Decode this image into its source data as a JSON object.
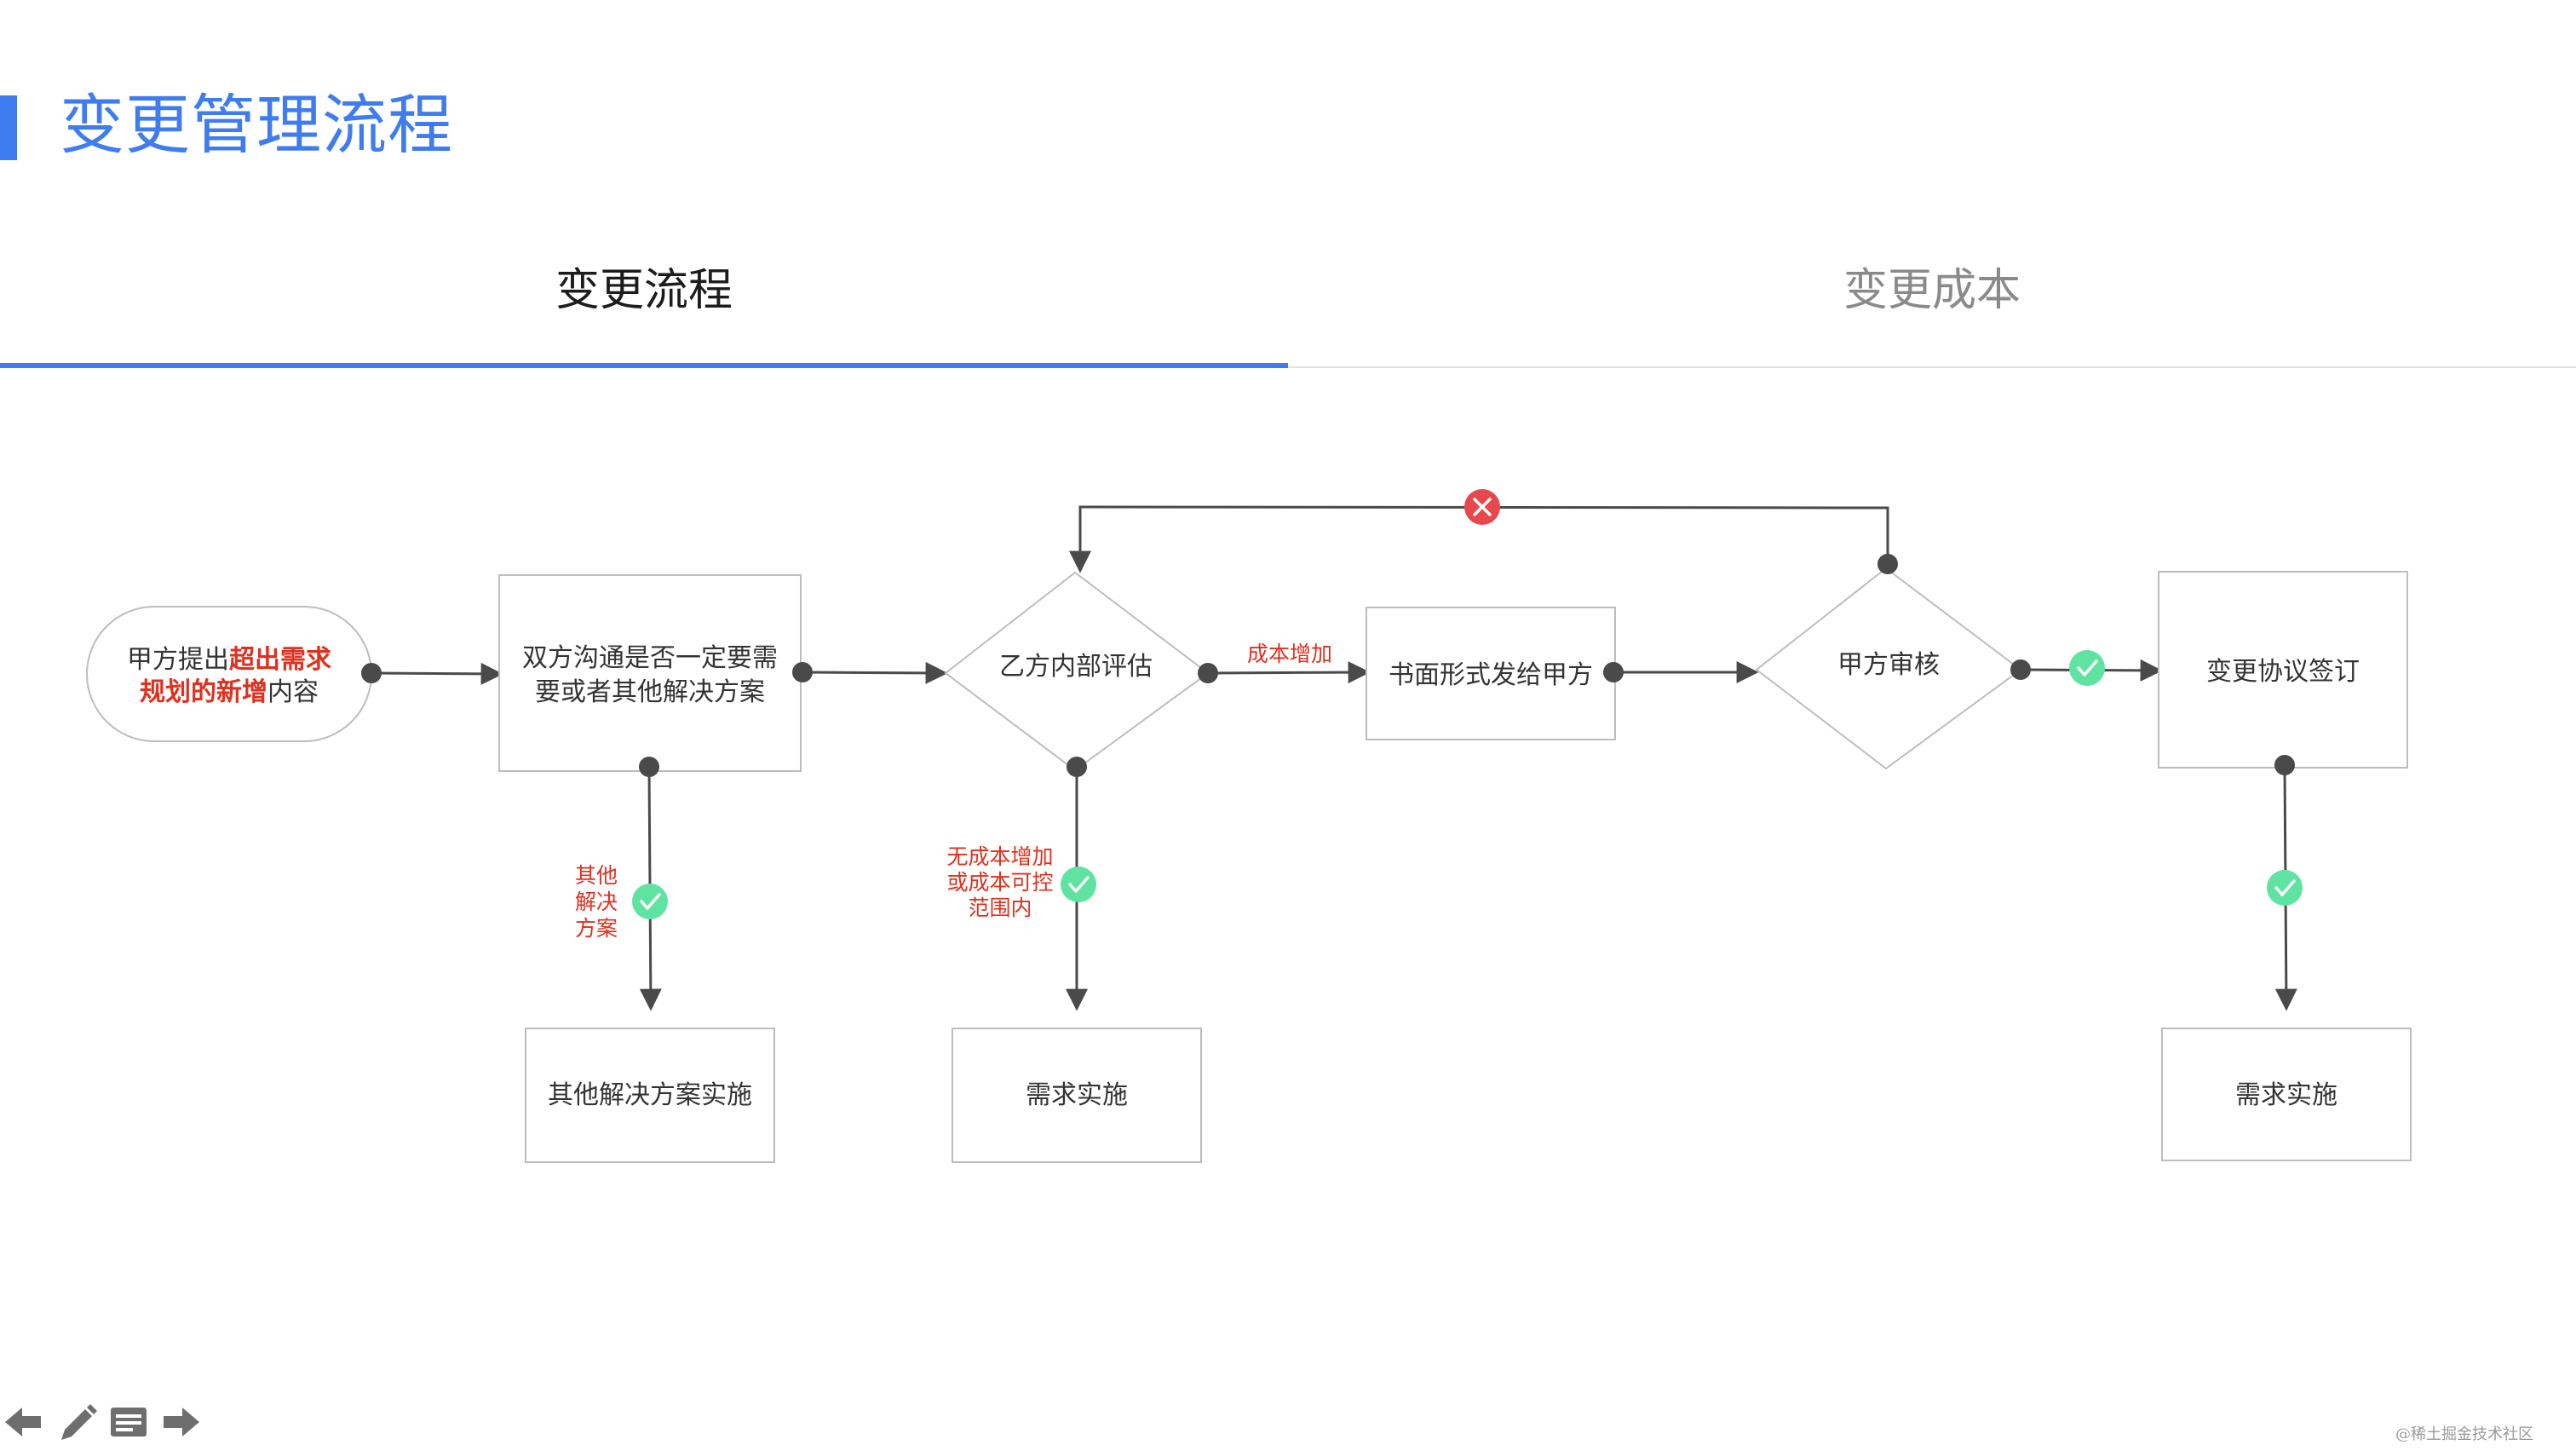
{
  "page": {
    "title": "变更管理流程",
    "accent_color": "#3f7cf0"
  },
  "tabs": [
    {
      "label": "变更流程",
      "active": true
    },
    {
      "label": "变更成本",
      "active": false
    }
  ],
  "flow": {
    "start": {
      "line1_prefix": "甲方提出",
      "line1_highlight": "超出需求",
      "line2_highlight": "规划的新增",
      "line2_suffix": "内容"
    },
    "communicate": {
      "line1": "双方沟通是否一定要需",
      "line2": "要或者其他解决方案"
    },
    "evaluate": {
      "label": "乙方内部评估"
    },
    "written": {
      "label": "书面形式发给甲方"
    },
    "review": {
      "label": "甲方审核"
    },
    "sign": {
      "label": "变更协议签订"
    },
    "alt_solution": {
      "label": "其他解决方案实施"
    },
    "implement_1": {
      "label": "需求实施"
    },
    "implement_2": {
      "label": "需求实施"
    },
    "labels": {
      "cost_increase": "成本增加",
      "other_solution": [
        "其他",
        "解决",
        "方案"
      ],
      "no_cost": [
        "无成本增加",
        "或成本可控",
        "范围内"
      ]
    },
    "colors": {
      "highlight": "#e0301e",
      "check": "#5fe3a1",
      "reject": "#e8474e",
      "node": "#4a4a4a"
    }
  },
  "controls": {
    "icons": [
      "arrow-left-icon",
      "pen-icon",
      "notes-icon",
      "arrow-right-icon"
    ]
  },
  "watermark": "@稀土掘金技术社区"
}
